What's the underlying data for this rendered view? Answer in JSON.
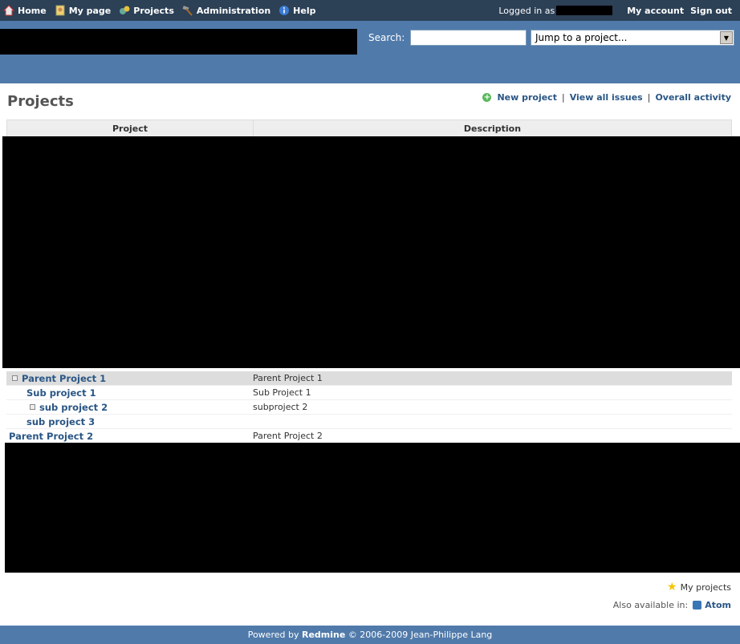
{
  "top_menu": {
    "items": [
      {
        "label": "Home",
        "icon": "home-icon"
      },
      {
        "label": "My page",
        "icon": "user-page-icon"
      },
      {
        "label": "Projects",
        "icon": "projects-icon"
      },
      {
        "label": "Administration",
        "icon": "hammer-icon"
      },
      {
        "label": "Help",
        "icon": "info-icon"
      }
    ],
    "logged_in_as": "Logged in as",
    "my_account": "My account",
    "sign_out": "Sign out"
  },
  "header": {
    "search_label": "Search:",
    "search_value": "",
    "jump_label": "Jump to a project..."
  },
  "page": {
    "title": "Projects",
    "new_project": "New project",
    "view_all_issues": "View all issues",
    "overall_activity": "Overall activity"
  },
  "table": {
    "headers": [
      "Project",
      "Description"
    ],
    "rows": [
      {
        "name": "Parent Project 1",
        "description": "Parent Project 1"
      },
      {
        "name": "Sub project 1",
        "description": "Sub Project 1"
      },
      {
        "name": "sub project 2",
        "description": "subproject 2"
      },
      {
        "name": "sub project 3",
        "description": ""
      },
      {
        "name": "Parent Project 2",
        "description": "Parent Project 2"
      }
    ]
  },
  "sidebar": {
    "my_projects": "My projects",
    "also_available": "Also available in:",
    "atom": "Atom"
  },
  "footer": {
    "powered_by": "Powered by",
    "redmine": "Redmine",
    "copyright": "© 2006-2009 Jean-Philippe Lang"
  },
  "colors": {
    "top_menu_bg": "#2C4056",
    "header_bg": "#507AAA",
    "link": "#2A5685"
  }
}
